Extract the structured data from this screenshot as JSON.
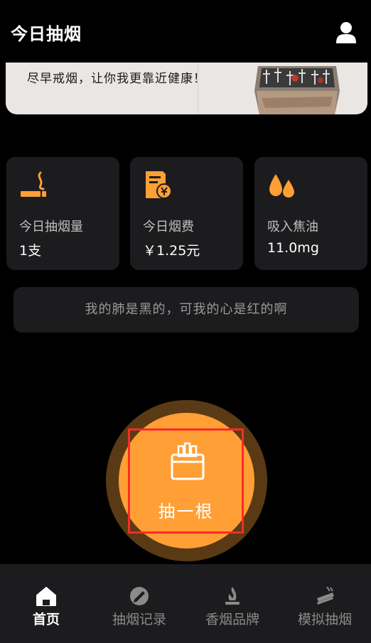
{
  "header": {
    "title": "今日抽烟",
    "user_icon": "user-icon"
  },
  "banner": {
    "text": "尽早戒烟，让你我更靠近健康！"
  },
  "stats": [
    {
      "icon": "cigarette-icon",
      "label": "今日抽烟量",
      "value": "1支"
    },
    {
      "icon": "bill-icon",
      "label": "今日烟费",
      "value": "￥1.25元"
    },
    {
      "icon": "drops-icon",
      "label": "吸入焦油",
      "value": "11.0mg"
    }
  ],
  "quote": "我的肺是黑的，可我的心是红的啊",
  "smoke_button": {
    "label": "抽一根",
    "icon": "cigarette-pack-icon"
  },
  "tabs": [
    {
      "label": "首页",
      "icon": "home-icon",
      "active": true
    },
    {
      "label": "抽烟记录",
      "icon": "record-icon",
      "active": false
    },
    {
      "label": "香烟品牌",
      "icon": "flame-icon",
      "active": false
    },
    {
      "label": "模拟抽烟",
      "icon": "simulate-smoke-icon",
      "active": false
    }
  ],
  "colors": {
    "accent": "#ff9f35",
    "accent_dark": "#5a3a14",
    "card_bg": "#1c1c1e",
    "background": "#000000",
    "highlight_border": "#ff2a2a"
  }
}
